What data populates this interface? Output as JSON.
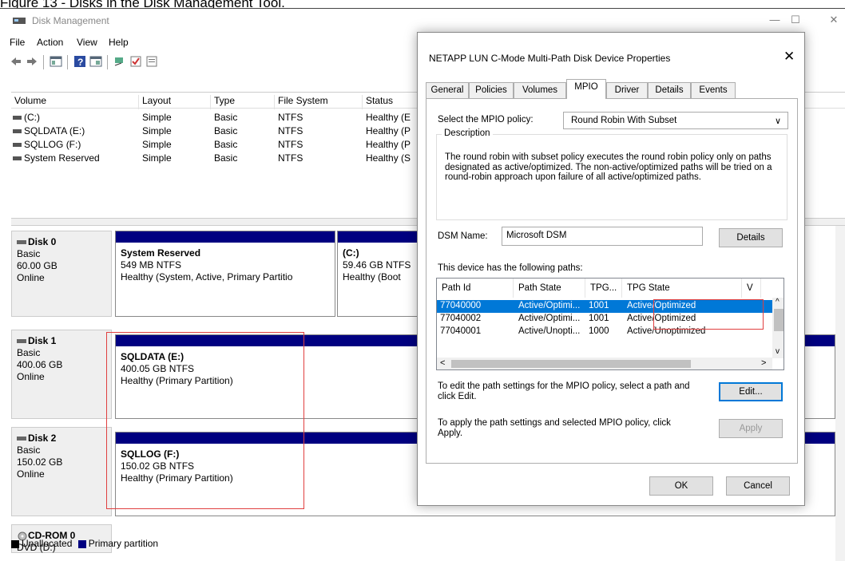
{
  "caption": "Figure 13 - Disks in the Disk Management Tool.",
  "window": {
    "title": "Disk Management",
    "minimize": "—",
    "maximize": "☐",
    "close": "✕"
  },
  "menu": [
    "File",
    "Action",
    "View",
    "Help"
  ],
  "volumes": {
    "headers": [
      "Volume",
      "Layout",
      "Type",
      "File System",
      "Status"
    ],
    "rows": [
      {
        "volume": "(C:)",
        "layout": "Simple",
        "type": "Basic",
        "fs": "NTFS",
        "status": "Healthy (E"
      },
      {
        "volume": "SQLDATA (E:)",
        "layout": "Simple",
        "type": "Basic",
        "fs": "NTFS",
        "status": "Healthy (P"
      },
      {
        "volume": "SQLLOG (F:)",
        "layout": "Simple",
        "type": "Basic",
        "fs": "NTFS",
        "status": "Healthy (P"
      },
      {
        "volume": "System Reserved",
        "layout": "Simple",
        "type": "Basic",
        "fs": "NTFS",
        "status": "Healthy (S"
      }
    ]
  },
  "disks": [
    {
      "name": "Disk 0",
      "kind": "Basic",
      "size": "60.00 GB",
      "state": "Online",
      "parts": [
        {
          "title": "System Reserved",
          "size": "549 MB NTFS",
          "status": "Healthy (System, Active, Primary Partitio"
        },
        {
          "title": "(C:)",
          "size": "59.46 GB NTFS",
          "status": "Healthy (Boot"
        }
      ]
    },
    {
      "name": "Disk 1",
      "kind": "Basic",
      "size": "400.06 GB",
      "state": "Online",
      "parts": [
        {
          "title": "SQLDATA  (E:)",
          "size": "400.05 GB NTFS",
          "status": "Healthy (Primary Partition)"
        }
      ]
    },
    {
      "name": "Disk 2",
      "kind": "Basic",
      "size": "150.02 GB",
      "state": "Online",
      "parts": [
        {
          "title": "SQLLOG  (F:)",
          "size": "150.02 GB NTFS",
          "status": "Healthy (Primary Partition)"
        }
      ]
    },
    {
      "name": "CD-ROM 0",
      "kind": "DVD (D:)"
    }
  ],
  "legend": {
    "unallocated": "Unallocated",
    "primary": "Primary partition",
    "unallocated_color": "#000000",
    "primary_color": "#000080"
  },
  "dialog": {
    "title": "NETAPP LUN C-Mode  Multi-Path Disk Device Properties",
    "close": "✕",
    "tabs": [
      "General",
      "Policies",
      "Volumes",
      "MPIO",
      "Driver",
      "Details",
      "Events"
    ],
    "active_tab": "MPIO",
    "policy_label": "Select the MPIO policy:",
    "policy_value": "Round Robin With Subset",
    "description_title": "Description",
    "description": "The round robin with subset policy executes the round robin policy only on paths designated as active/optimized.  The non-active/optimized paths will be tried on a round-robin approach upon failure of all active/optimized paths.",
    "dsm_label": "DSM Name:",
    "dsm_value": "Microsoft DSM",
    "details_button": "Details",
    "paths_label": "This device has the following paths:",
    "path_headers": [
      "Path Id",
      "Path State",
      "TPG...",
      "TPG State",
      "V"
    ],
    "paths": [
      {
        "id": "77040000",
        "state": "Active/Optimi...",
        "tpg": "1001",
        "tpg_state": "Active/Optimized"
      },
      {
        "id": "77040002",
        "state": "Active/Optimi...",
        "tpg": "1001",
        "tpg_state": "Active/Optimized"
      },
      {
        "id": "77040001",
        "state": "Active/Unopti...",
        "tpg": "1000",
        "tpg_state": "Active/Unoptimized"
      }
    ],
    "edit_text": "To edit the path settings for the MPIO policy, select a path and click Edit.",
    "edit_button": "Edit...",
    "apply_text": "To apply the path settings and selected MPIO policy, click Apply.",
    "apply_button": "Apply",
    "ok_button": "OK",
    "cancel_button": "Cancel"
  }
}
